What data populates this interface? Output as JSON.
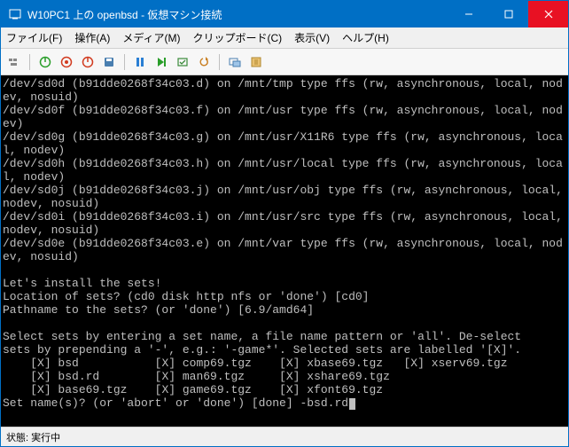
{
  "window": {
    "title": "W10PC1 上の openbsd - 仮想マシン接続"
  },
  "menu": {
    "file": "ファイル(F)",
    "action": "操作(A)",
    "media": "メディア(M)",
    "clipboard": "クリップボード(C)",
    "view": "表示(V)",
    "help": "ヘルプ(H)"
  },
  "terminal_text": "/dev/sd0d (b91dde0268f34c03.d) on /mnt/tmp type ffs (rw, asynchronous, local, nodev, nosuid)\n/dev/sd0f (b91dde0268f34c03.f) on /mnt/usr type ffs (rw, asynchronous, local, nodev)\n/dev/sd0g (b91dde0268f34c03.g) on /mnt/usr/X11R6 type ffs (rw, asynchronous, local, nodev)\n/dev/sd0h (b91dde0268f34c03.h) on /mnt/usr/local type ffs (rw, asynchronous, local, nodev)\n/dev/sd0j (b91dde0268f34c03.j) on /mnt/usr/obj type ffs (rw, asynchronous, local, nodev, nosuid)\n/dev/sd0i (b91dde0268f34c03.i) on /mnt/usr/src type ffs (rw, asynchronous, local, nodev, nosuid)\n/dev/sd0e (b91dde0268f34c03.e) on /mnt/var type ffs (rw, asynchronous, local, nodev, nosuid)\n\nLet's install the sets!\nLocation of sets? (cd0 disk http nfs or 'done') [cd0]\nPathname to the sets? (or 'done') [6.9/amd64]\n\nSelect sets by entering a set name, a file name pattern or 'all'. De-select\nsets by prepending a '-', e.g.: '-game*'. Selected sets are labelled '[X]'.\n    [X] bsd           [X] comp69.tgz    [X] xbase69.tgz   [X] xserv69.tgz\n    [X] bsd.rd        [X] man69.tgz     [X] xshare69.tgz\n    [X] base69.tgz    [X] game69.tgz    [X] xfont69.tgz\nSet name(s)? (or 'abort' or 'done') [done] -bsd.rd",
  "status": {
    "label": "状態:",
    "value": "実行中"
  }
}
